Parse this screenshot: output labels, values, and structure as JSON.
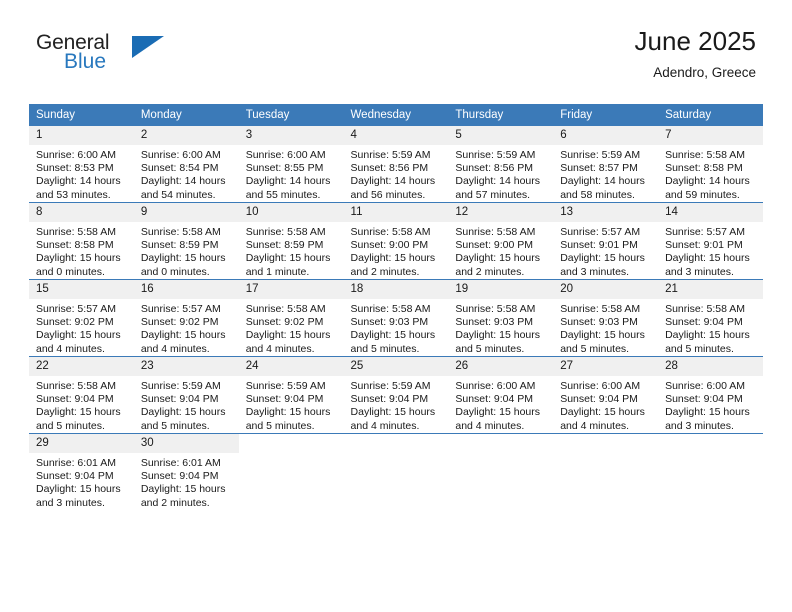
{
  "logo": {
    "line1": "General",
    "line2": "Blue",
    "triangle_icon": "triangle-icon",
    "brand_color": "#2878BE"
  },
  "header": {
    "title": "June 2025",
    "subtitle": "Adendro, Greece"
  },
  "theme": {
    "header_blue": "#3B7AB8",
    "daynum_gray": "#F0F0F0"
  },
  "calendar": {
    "weekday_headers": [
      "Sunday",
      "Monday",
      "Tuesday",
      "Wednesday",
      "Thursday",
      "Friday",
      "Saturday"
    ],
    "weeks": [
      [
        {
          "day": "1",
          "sunrise": "Sunrise: 6:00 AM",
          "sunset": "Sunset: 8:53 PM",
          "daylight1": "Daylight: 14 hours",
          "daylight2": "and 53 minutes."
        },
        {
          "day": "2",
          "sunrise": "Sunrise: 6:00 AM",
          "sunset": "Sunset: 8:54 PM",
          "daylight1": "Daylight: 14 hours",
          "daylight2": "and 54 minutes."
        },
        {
          "day": "3",
          "sunrise": "Sunrise: 6:00 AM",
          "sunset": "Sunset: 8:55 PM",
          "daylight1": "Daylight: 14 hours",
          "daylight2": "and 55 minutes."
        },
        {
          "day": "4",
          "sunrise": "Sunrise: 5:59 AM",
          "sunset": "Sunset: 8:56 PM",
          "daylight1": "Daylight: 14 hours",
          "daylight2": "and 56 minutes."
        },
        {
          "day": "5",
          "sunrise": "Sunrise: 5:59 AM",
          "sunset": "Sunset: 8:56 PM",
          "daylight1": "Daylight: 14 hours",
          "daylight2": "and 57 minutes."
        },
        {
          "day": "6",
          "sunrise": "Sunrise: 5:59 AM",
          "sunset": "Sunset: 8:57 PM",
          "daylight1": "Daylight: 14 hours",
          "daylight2": "and 58 minutes."
        },
        {
          "day": "7",
          "sunrise": "Sunrise: 5:58 AM",
          "sunset": "Sunset: 8:58 PM",
          "daylight1": "Daylight: 14 hours",
          "daylight2": "and 59 minutes."
        }
      ],
      [
        {
          "day": "8",
          "sunrise": "Sunrise: 5:58 AM",
          "sunset": "Sunset: 8:58 PM",
          "daylight1": "Daylight: 15 hours",
          "daylight2": "and 0 minutes."
        },
        {
          "day": "9",
          "sunrise": "Sunrise: 5:58 AM",
          "sunset": "Sunset: 8:59 PM",
          "daylight1": "Daylight: 15 hours",
          "daylight2": "and 0 minutes."
        },
        {
          "day": "10",
          "sunrise": "Sunrise: 5:58 AM",
          "sunset": "Sunset: 8:59 PM",
          "daylight1": "Daylight: 15 hours",
          "daylight2": "and 1 minute."
        },
        {
          "day": "11",
          "sunrise": "Sunrise: 5:58 AM",
          "sunset": "Sunset: 9:00 PM",
          "daylight1": "Daylight: 15 hours",
          "daylight2": "and 2 minutes."
        },
        {
          "day": "12",
          "sunrise": "Sunrise: 5:58 AM",
          "sunset": "Sunset: 9:00 PM",
          "daylight1": "Daylight: 15 hours",
          "daylight2": "and 2 minutes."
        },
        {
          "day": "13",
          "sunrise": "Sunrise: 5:57 AM",
          "sunset": "Sunset: 9:01 PM",
          "daylight1": "Daylight: 15 hours",
          "daylight2": "and 3 minutes."
        },
        {
          "day": "14",
          "sunrise": "Sunrise: 5:57 AM",
          "sunset": "Sunset: 9:01 PM",
          "daylight1": "Daylight: 15 hours",
          "daylight2": "and 3 minutes."
        }
      ],
      [
        {
          "day": "15",
          "sunrise": "Sunrise: 5:57 AM",
          "sunset": "Sunset: 9:02 PM",
          "daylight1": "Daylight: 15 hours",
          "daylight2": "and 4 minutes."
        },
        {
          "day": "16",
          "sunrise": "Sunrise: 5:57 AM",
          "sunset": "Sunset: 9:02 PM",
          "daylight1": "Daylight: 15 hours",
          "daylight2": "and 4 minutes."
        },
        {
          "day": "17",
          "sunrise": "Sunrise: 5:58 AM",
          "sunset": "Sunset: 9:02 PM",
          "daylight1": "Daylight: 15 hours",
          "daylight2": "and 4 minutes."
        },
        {
          "day": "18",
          "sunrise": "Sunrise: 5:58 AM",
          "sunset": "Sunset: 9:03 PM",
          "daylight1": "Daylight: 15 hours",
          "daylight2": "and 5 minutes."
        },
        {
          "day": "19",
          "sunrise": "Sunrise: 5:58 AM",
          "sunset": "Sunset: 9:03 PM",
          "daylight1": "Daylight: 15 hours",
          "daylight2": "and 5 minutes."
        },
        {
          "day": "20",
          "sunrise": "Sunrise: 5:58 AM",
          "sunset": "Sunset: 9:03 PM",
          "daylight1": "Daylight: 15 hours",
          "daylight2": "and 5 minutes."
        },
        {
          "day": "21",
          "sunrise": "Sunrise: 5:58 AM",
          "sunset": "Sunset: 9:04 PM",
          "daylight1": "Daylight: 15 hours",
          "daylight2": "and 5 minutes."
        }
      ],
      [
        {
          "day": "22",
          "sunrise": "Sunrise: 5:58 AM",
          "sunset": "Sunset: 9:04 PM",
          "daylight1": "Daylight: 15 hours",
          "daylight2": "and 5 minutes."
        },
        {
          "day": "23",
          "sunrise": "Sunrise: 5:59 AM",
          "sunset": "Sunset: 9:04 PM",
          "daylight1": "Daylight: 15 hours",
          "daylight2": "and 5 minutes."
        },
        {
          "day": "24",
          "sunrise": "Sunrise: 5:59 AM",
          "sunset": "Sunset: 9:04 PM",
          "daylight1": "Daylight: 15 hours",
          "daylight2": "and 5 minutes."
        },
        {
          "day": "25",
          "sunrise": "Sunrise: 5:59 AM",
          "sunset": "Sunset: 9:04 PM",
          "daylight1": "Daylight: 15 hours",
          "daylight2": "and 4 minutes."
        },
        {
          "day": "26",
          "sunrise": "Sunrise: 6:00 AM",
          "sunset": "Sunset: 9:04 PM",
          "daylight1": "Daylight: 15 hours",
          "daylight2": "and 4 minutes."
        },
        {
          "day": "27",
          "sunrise": "Sunrise: 6:00 AM",
          "sunset": "Sunset: 9:04 PM",
          "daylight1": "Daylight: 15 hours",
          "daylight2": "and 4 minutes."
        },
        {
          "day": "28",
          "sunrise": "Sunrise: 6:00 AM",
          "sunset": "Sunset: 9:04 PM",
          "daylight1": "Daylight: 15 hours",
          "daylight2": "and 3 minutes."
        }
      ],
      [
        {
          "day": "29",
          "sunrise": "Sunrise: 6:01 AM",
          "sunset": "Sunset: 9:04 PM",
          "daylight1": "Daylight: 15 hours",
          "daylight2": "and 3 minutes."
        },
        {
          "day": "30",
          "sunrise": "Sunrise: 6:01 AM",
          "sunset": "Sunset: 9:04 PM",
          "daylight1": "Daylight: 15 hours",
          "daylight2": "and 2 minutes."
        },
        {
          "day": "",
          "sunrise": "",
          "sunset": "",
          "daylight1": "",
          "daylight2": ""
        },
        {
          "day": "",
          "sunrise": "",
          "sunset": "",
          "daylight1": "",
          "daylight2": ""
        },
        {
          "day": "",
          "sunrise": "",
          "sunset": "",
          "daylight1": "",
          "daylight2": ""
        },
        {
          "day": "",
          "sunrise": "",
          "sunset": "",
          "daylight1": "",
          "daylight2": ""
        },
        {
          "day": "",
          "sunrise": "",
          "sunset": "",
          "daylight1": "",
          "daylight2": ""
        }
      ]
    ]
  }
}
